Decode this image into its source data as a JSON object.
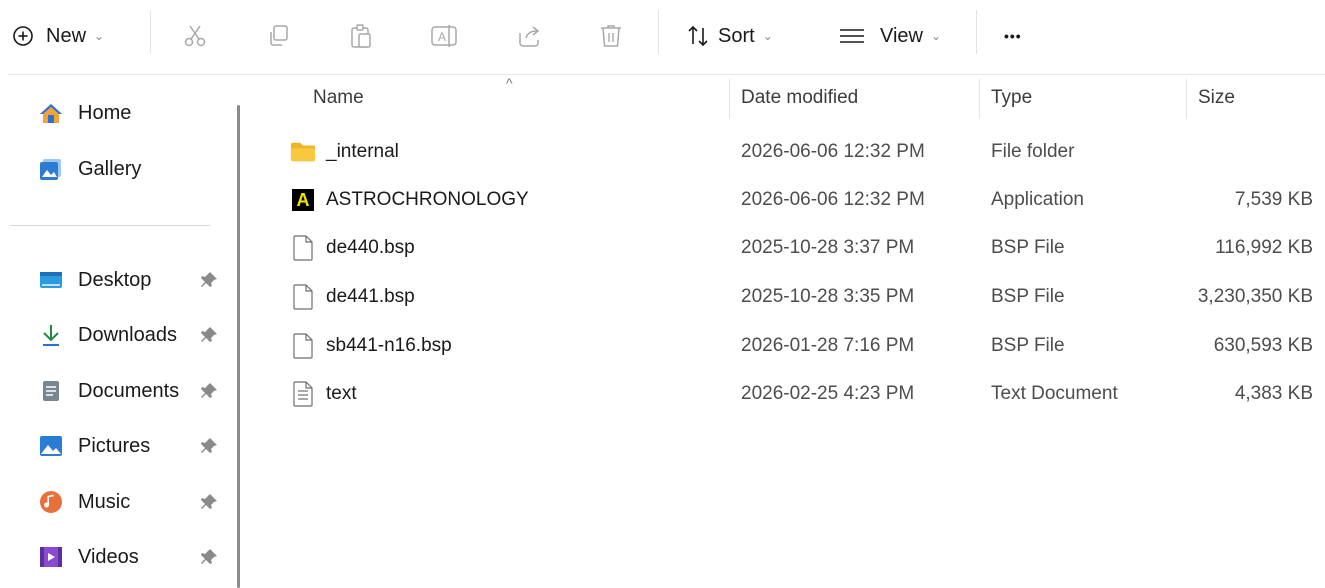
{
  "toolbar": {
    "new_label": "New",
    "sort_label": "Sort",
    "view_label": "View",
    "more_label": "•••",
    "icons": [
      "plus-circle-icon",
      "cut-icon",
      "copy-icon",
      "paste-icon",
      "rename-icon",
      "share-icon",
      "delete-icon",
      "sort-icon",
      "view-icon",
      "more-icon"
    ]
  },
  "sidebar": {
    "top_items": [
      {
        "label": "Home",
        "icon": "home-icon"
      },
      {
        "label": "Gallery",
        "icon": "gallery-icon"
      }
    ],
    "pinned_items": [
      {
        "label": "Desktop",
        "icon": "desktop-icon"
      },
      {
        "label": "Downloads",
        "icon": "downloads-icon"
      },
      {
        "label": "Documents",
        "icon": "documents-icon"
      },
      {
        "label": "Pictures",
        "icon": "pictures-icon"
      },
      {
        "label": "Music",
        "icon": "music-icon"
      },
      {
        "label": "Videos",
        "icon": "videos-icon"
      }
    ]
  },
  "columns": {
    "name": "Name",
    "date": "Date modified",
    "type": "Type",
    "size": "Size",
    "sort_indicator": "^"
  },
  "files": [
    {
      "name": "_internal",
      "date": "2026-06-06 12:32 PM",
      "type": "File folder",
      "size": "",
      "icon": "folder-icon"
    },
    {
      "name": "ASTROCHRONOLOGY",
      "date": "2026-06-06 12:32 PM",
      "type": "Application",
      "size": "7,539 KB",
      "icon": "app-icon",
      "app_letter": "A"
    },
    {
      "name": "de440.bsp",
      "date": "2025-10-28 3:37 PM",
      "type": "BSP File",
      "size": "116,992 KB",
      "icon": "file-icon"
    },
    {
      "name": "de441.bsp",
      "date": "2025-10-28 3:35 PM",
      "type": "BSP File",
      "size": "3,230,350 KB",
      "icon": "file-icon"
    },
    {
      "name": "sb441-n16.bsp",
      "date": "2026-01-28 7:16 PM",
      "type": "BSP File",
      "size": "630,593 KB",
      "icon": "file-icon"
    },
    {
      "name": "text",
      "date": "2026-02-25 4:23 PM",
      "type": "Text Document",
      "size": "4,383 KB",
      "icon": "text-file-icon"
    }
  ],
  "colors": {
    "folder": "#f8c940",
    "app_bg": "#000000",
    "app_fg": "#f5e400",
    "accent": "#0067c0"
  }
}
